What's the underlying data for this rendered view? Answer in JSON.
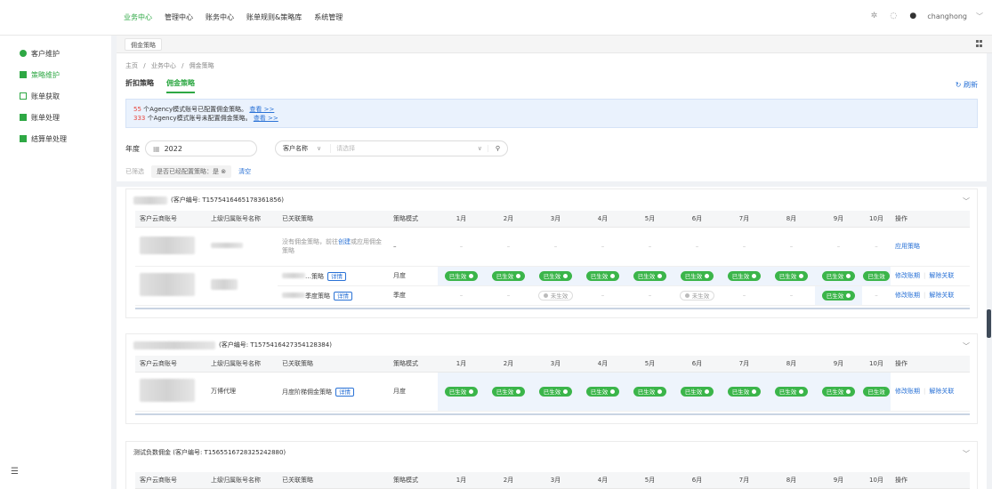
{
  "topnav": [
    "业务中心",
    "管理中心",
    "账务中心",
    "账单规则&策略库",
    "系统管理"
  ],
  "user": "changhong",
  "sidebar": [
    "客户维护",
    "策略维护",
    "账单获取",
    "账单处理",
    "结算单处理"
  ],
  "tab_chip": "佣金策略",
  "breadcrumb": [
    "主页",
    "/",
    "业务中心",
    "/",
    "佣金策略"
  ],
  "subtabs": [
    "折扣策略",
    "佣金策略"
  ],
  "refresh": "刷新",
  "notice": {
    "line1_count": "55",
    "line1_text": "个Agency模式账号已配置佣金策略。",
    "line2_count": "333",
    "line2_text": "个Agency模式账号未配置佣金策略。",
    "link": "查看 >>"
  },
  "filters": {
    "year_label": "年度",
    "year_value": "2022",
    "select_label": "客户名称",
    "placeholder": "请选择",
    "filtered_label": "已筛选",
    "tag": "是否已经配置策略：是",
    "clear": "清空"
  },
  "table_headers": [
    "客户云商账号",
    "上级归属账号名称",
    "已关联策略",
    "策略模式",
    "1月",
    "2月",
    "3月",
    "4月",
    "5月",
    "6月",
    "7月",
    "8月",
    "9月",
    "10月",
    "操作"
  ],
  "cards": [
    {
      "title": "(客户编号: T1575416465178361856)",
      "rows": [
        {
          "policy_text": "没有佣金策略，前往",
          "create": "创建",
          "policy_text2": "或应用佣金策略",
          "mode": "–",
          "action": "应用策略"
        },
        {
          "policy": "…策略",
          "detail": "详情",
          "mode": "月度",
          "status": "已生效",
          "action1": "修改账期",
          "action2": "解除关联"
        },
        {
          "policy": "季度策略",
          "detail": "详情",
          "mode": "季度",
          "status_on": "已生效",
          "status_off": "未生效",
          "action1": "修改账期",
          "action2": "解除关联"
        }
      ]
    },
    {
      "title": "(客户编号: T1575416427354128384)",
      "rows": [
        {
          "parent": "万博代理",
          "policy": "月度阶梯佣金策略",
          "detail": "详情",
          "mode": "月度",
          "status": "已生效",
          "action1": "修改账期",
          "action2": "解除关联"
        }
      ]
    },
    {
      "title": "测试负数佣金  (客户编号: T1565516728325242880)"
    }
  ]
}
